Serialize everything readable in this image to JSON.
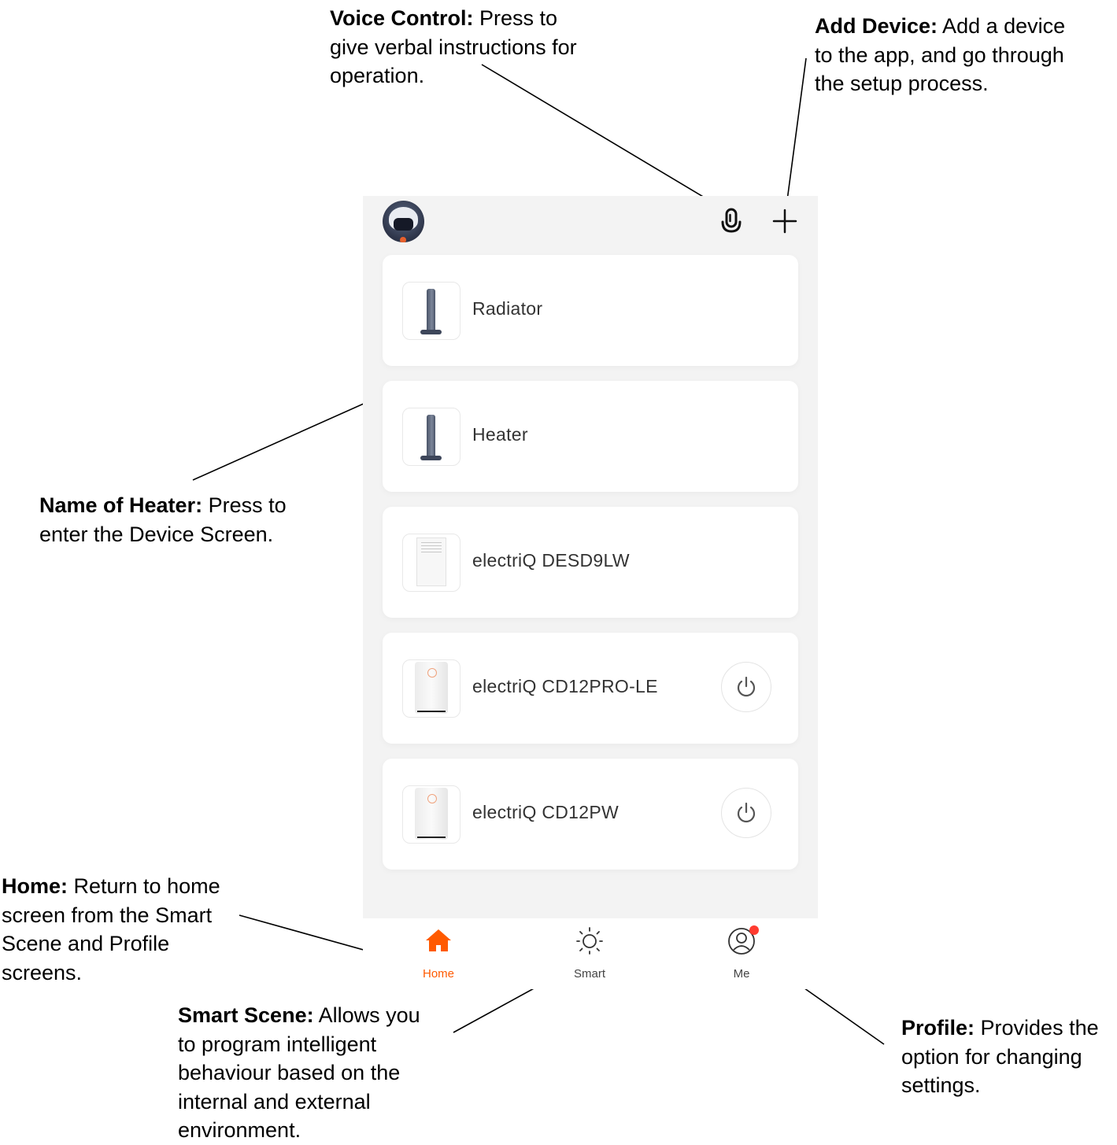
{
  "annotations": {
    "voice": {
      "title": "Voice Control:",
      "lines": [
        " Press to",
        "give verbal instructions for",
        "operation."
      ]
    },
    "add": {
      "title": "Add Device:",
      "lines": [
        " Add a device",
        "to the app, and go through",
        "the setup process."
      ]
    },
    "name": {
      "title": "Name of Heater:",
      "lines": [
        " Press to",
        "enter the Device Screen."
      ]
    },
    "home": {
      "title": "Home:",
      "lines": [
        " Return to home",
        "screen from the Smart",
        "Scene and Profile",
        "screens."
      ]
    },
    "smart": {
      "title": "Smart Scene:",
      "lines": [
        " Allows you",
        "to program intelligent",
        "behaviour based on the",
        "internal and external",
        "environment."
      ]
    },
    "profile": {
      "title": "Profile:",
      "lines": [
        " Provides the",
        "option for changing",
        "settings."
      ]
    }
  },
  "header": {
    "avatar_icon": "robot-avatar-icon",
    "mic_icon": "microphone-icon",
    "add_icon": "plus-icon"
  },
  "devices": [
    {
      "name": "Radiator",
      "thumb": "tower-heater",
      "power": false
    },
    {
      "name": "Heater",
      "thumb": "tower-heater",
      "power": false
    },
    {
      "name": "electriQ DESD9LW",
      "thumb": "box-unit",
      "power": false
    },
    {
      "name": "electriQ CD12PRO-LE",
      "thumb": "dehumidifier",
      "power": true
    },
    {
      "name": "electriQ CD12PW",
      "thumb": "dehumidifier",
      "power": true
    }
  ],
  "tabs": [
    {
      "label": "Home",
      "icon": "home-icon",
      "active": true
    },
    {
      "label": "Smart",
      "icon": "sun-icon",
      "active": false
    },
    {
      "label": "Me",
      "icon": "user-icon",
      "active": false,
      "badge": true
    }
  ],
  "colors": {
    "accent": "#ff5a00",
    "screen_bg": "#f3f3f3",
    "card_bg": "#ffffff",
    "badge": "#ff3b30"
  }
}
